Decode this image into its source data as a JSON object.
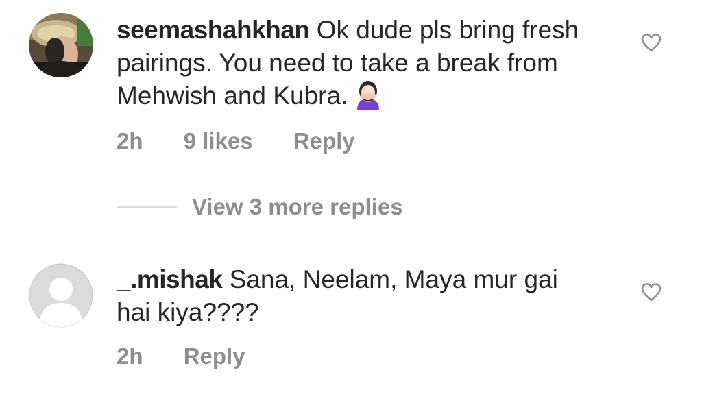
{
  "comments": [
    {
      "username": "seemashahkhan",
      "text": "Ok dude pls bring fresh pairings. You need to take a break from Mehwish and Kubra.",
      "emoji": "face-palm-emoji",
      "time": "2h",
      "likes": "9 likes",
      "reply_label": "Reply",
      "avatar": "profile-photo"
    },
    {
      "username": "_.mishak",
      "text": "Sana, Neelam, Maya mur gai hai kiya????",
      "time": "2h",
      "reply_label": "Reply",
      "avatar": "default-avatar"
    }
  ],
  "view_replies_label": "View 3 more replies",
  "icons": {
    "like": "heart-outline-icon"
  },
  "colors": {
    "text": "#262626",
    "secondary": "#8e8e8e",
    "divider": "#dbdbdb",
    "default_avatar_bg": "#dbdbdb"
  }
}
